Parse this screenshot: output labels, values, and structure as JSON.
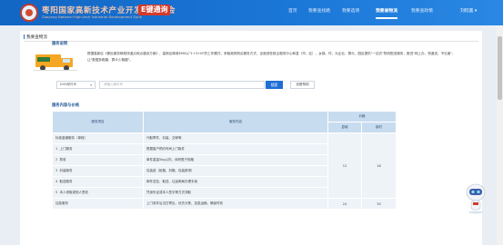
{
  "header": {
    "title": "枣阳国家高新技术产业开发区管委会",
    "subtitle": "Zaoyang National High-tech Industrial Development Zone",
    "badge": "E键通询",
    "nav": [
      {
        "label": "首页",
        "active": false
      },
      {
        "label": "我要查找路",
        "active": false
      },
      {
        "label": "我要选项",
        "active": false
      },
      {
        "label": "我要查物流",
        "active": true
      },
      {
        "label": "我要查政策",
        "active": false
      }
    ],
    "user_menu": "刘钧宽 ▾"
  },
  "panel": {
    "title": "我要查物流",
    "intro": {
      "heading": "服务说明",
      "text": "根据高新区《便民服务邮政快递点网点建设方案》，高新区邮政EMS以\"1+3+N\"的工作模式，采取政府购买服务方式，全面进驻政企服务中心和县（市、区）、乡镇、村，为企业、群众、园区提供\"一站式\"物流配送服务，推进\"网上办、快递送、不见面\"，让\"数据多跑路、群众少跑腿\"。"
    },
    "search": {
      "select_value": "EMS邮件号",
      "placeholder": "请输入邮件号",
      "search_label": "搜索",
      "help_label": "查看帮助"
    },
    "table_heading": "服务内容与价格",
    "table": {
      "headers": {
        "item": "服务项目",
        "content": "服务内容",
        "price": "价格",
        "zone": "县城",
        "town": "镇村"
      },
      "rows": [
        {
          "no": "",
          "item": "标准普通服务（单程）",
          "content": "代取寄件、封装、交邮等",
          "zone": "",
          "town": ""
        },
        {
          "no": "1",
          "item": "上门服务",
          "content": "根据客户预约时间上门取件",
          "zone": "",
          "town": ""
        },
        {
          "no": "2",
          "item": "揽收",
          "content": "单件重量5kg以内、体积限于规格",
          "zone": "",
          "town": ""
        },
        {
          "no": "3",
          "item": "封装服务",
          "content": "包装费（纸箱、封箱、包装胶带）",
          "zone": "12",
          "town": "18"
        },
        {
          "no": "4",
          "item": "取送服务",
          "content": "邮件送至、取送、往返邮局办理手续",
          "zone": "",
          "town": ""
        },
        {
          "no": "5",
          "item": "本人领取或他人签收",
          "content": "凭身份证或本人签字等方式领取",
          "zone": "",
          "town": ""
        },
        {
          "no": "",
          "item": "加急服务",
          "content": "上门收件后当日寄出，优先分拣、加急运输，确保时效",
          "zone": "24",
          "town": "30"
        }
      ]
    }
  },
  "colors": {
    "header_blue": "#1a76d6",
    "badge_red": "#d43a2a",
    "button_blue": "#1f6ed4",
    "table_header": "#c8dcef"
  }
}
